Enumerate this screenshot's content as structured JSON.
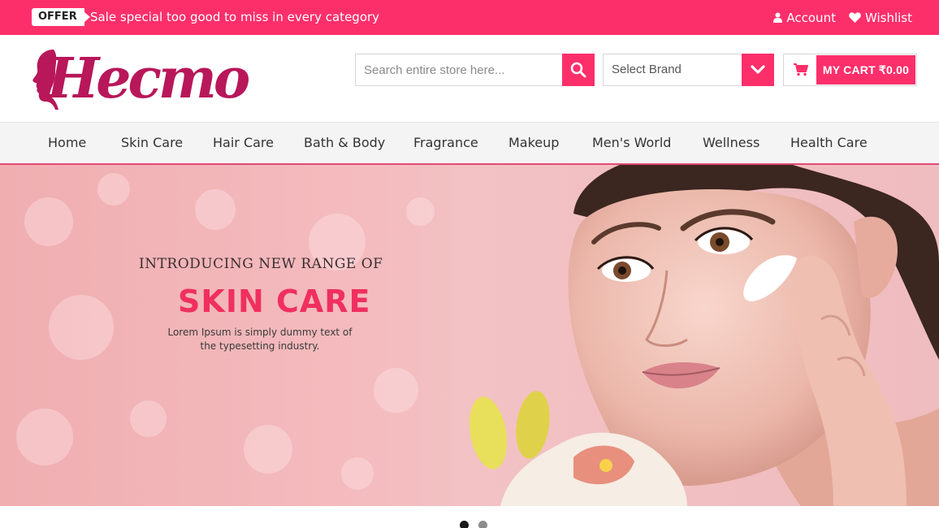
{
  "topbar": {
    "offer_badge": "OFFER",
    "offer_text": "Sale special too good to miss in every category",
    "account_label": "Account",
    "wishlist_label": "Wishlist"
  },
  "header": {
    "logo_text": "Hecmo",
    "search_placeholder": "Search entire store here...",
    "brand_select": "Select Brand",
    "cart_label": "MY CART ₹0.00"
  },
  "nav": {
    "items": [
      {
        "label": "Home"
      },
      {
        "label": "Skin Care"
      },
      {
        "label": "Hair Care"
      },
      {
        "label": "Bath & Body"
      },
      {
        "label": "Fragrance"
      },
      {
        "label": "Makeup"
      },
      {
        "label": "Men's World"
      },
      {
        "label": "Wellness"
      },
      {
        "label": "Health Care"
      }
    ]
  },
  "hero": {
    "kicker": "INTRODUCING NEW RANGE OF",
    "title": "SKIN CARE",
    "description": "Lorem Ipsum is simply dummy text of the typesetting industry."
  },
  "slider": {
    "active_slide": 1,
    "slide_count": 2
  },
  "colors": {
    "accent": "#fd2f6b",
    "logo": "#b8175a",
    "hero_title": "#f0305f"
  },
  "icons": {
    "account": "user-icon",
    "wishlist": "heart-icon",
    "search": "search-icon",
    "brand": "chevron-down-icon",
    "cart": "cart-icon"
  }
}
